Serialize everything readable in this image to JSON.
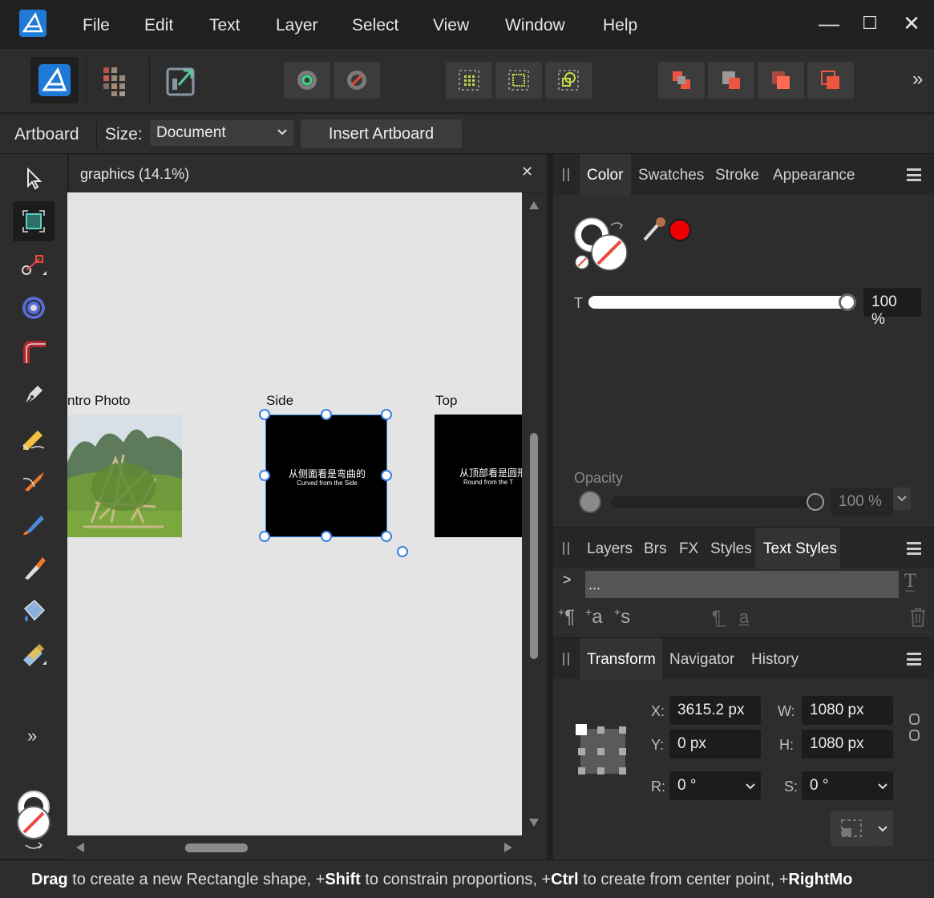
{
  "menubar": {
    "items": [
      "File",
      "Edit",
      "Text",
      "Layer",
      "Select",
      "View",
      "Window",
      "Help"
    ],
    "minimize": "—",
    "maximize": "☐",
    "close": "✕"
  },
  "toolbar": {
    "overflow": "»"
  },
  "context": {
    "tool_label": "Artboard",
    "size_label": "Size:",
    "size_value": "Document",
    "insert_button": "Insert Artboard"
  },
  "tools": {
    "more": "»"
  },
  "document": {
    "tab_title": "graphics (14.1%)",
    "close": "✕",
    "artboards": [
      {
        "label": "ntro Photo"
      },
      {
        "label": "Side",
        "zh": "从侧面看是弯曲的",
        "en": "Curved from the Side"
      },
      {
        "label": "Top",
        "zh": "从顶部看是圆形",
        "en": "Round from the T"
      }
    ]
  },
  "color_panel": {
    "tabs": [
      "Color",
      "Swatches",
      "Stroke",
      "Appearance"
    ],
    "active_tab": "Color",
    "t_label": "T",
    "t_value": "100 %",
    "t_fraction": 1.0,
    "opacity_label": "Opacity",
    "opacity_value": "100 %",
    "picked_color": "#ee0000"
  },
  "text_styles_panel": {
    "tabs": [
      "Layers",
      "Brs",
      "FX",
      "Styles",
      "Text Styles"
    ],
    "active_tab": "Text Styles",
    "expand": ">",
    "style_name": "..."
  },
  "transform_panel": {
    "tabs": [
      "Transform",
      "Navigator",
      "History"
    ],
    "active_tab": "Transform",
    "x_label": "X:",
    "x_value": "3615.2 px",
    "y_label": "Y:",
    "y_value": "0 px",
    "w_label": "W:",
    "w_value": "1080 px",
    "h_label": "H:",
    "h_value": "1080 px",
    "r_label": "R:",
    "r_value": "0 °",
    "s_label": "S:",
    "s_value": "0 °"
  },
  "status": {
    "b1": "Drag",
    "t1": " to create a new Rectangle shape, +",
    "b2": "Shift",
    "t2": " to constrain proportions, +",
    "b3": "Ctrl",
    "t3": " to create from center point, +",
    "b4": "RightMo"
  },
  "colors": {
    "accent": "#3b80e0",
    "selection": "#4a90ff",
    "panel": "#2d2d2d",
    "canvas": "#e4e4e4"
  }
}
